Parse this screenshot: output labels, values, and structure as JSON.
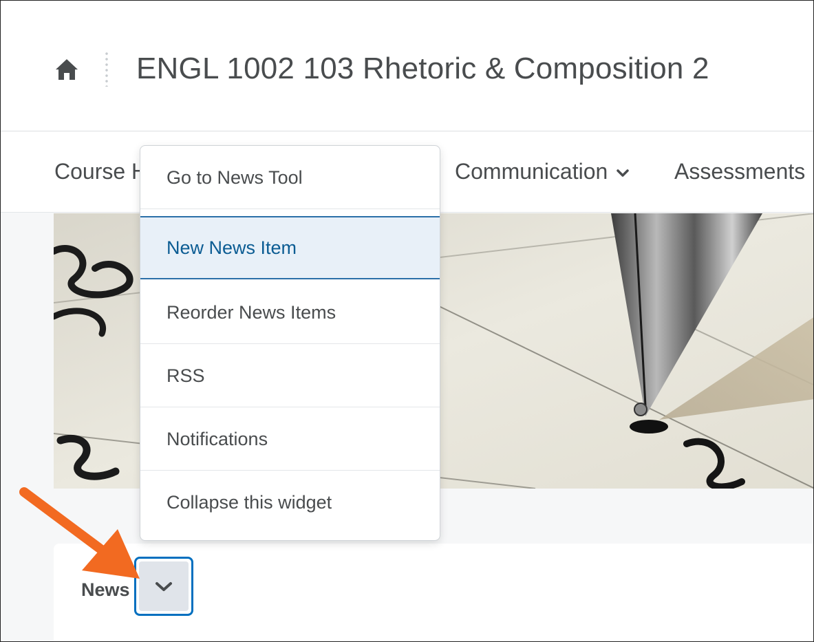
{
  "header": {
    "title": "ENGL 1002 103 Rhetoric & Composition 2"
  },
  "nav": {
    "items": [
      {
        "label": "Course H"
      },
      {
        "label": "Communication"
      },
      {
        "label": "Assessments"
      }
    ]
  },
  "menu": {
    "items": [
      {
        "label": "Go to News Tool"
      },
      {
        "label": "New News Item"
      },
      {
        "label": "Reorder News Items"
      },
      {
        "label": "RSS"
      },
      {
        "label": "Notifications"
      },
      {
        "label": "Collapse this widget"
      }
    ],
    "selected_index": 1
  },
  "widget": {
    "title": "News"
  },
  "icons": {
    "home": "home-icon",
    "nav_chevron": "chevron-down-icon",
    "widget_menu": "chevron-down-icon",
    "annotation": "arrow-icon"
  },
  "colors": {
    "accent": "#006fbf",
    "selected_bg": "#e8f0f8",
    "text": "#494c4e",
    "annotation_arrow": "#f26a21"
  }
}
